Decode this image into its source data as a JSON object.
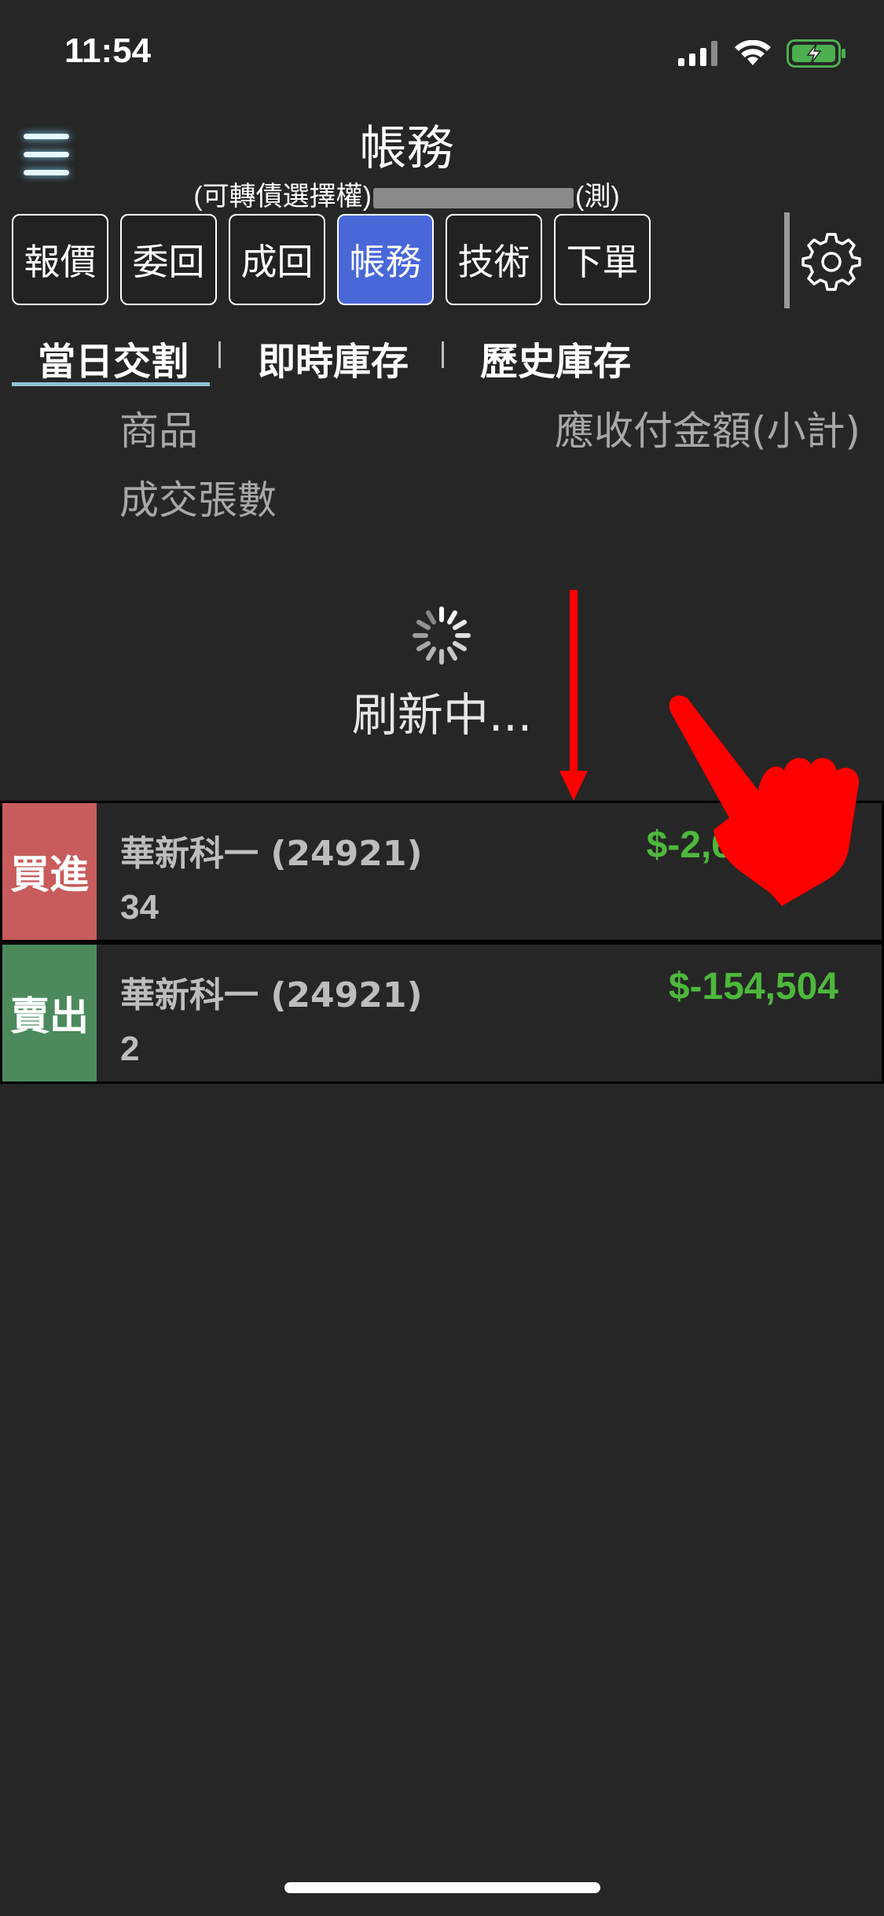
{
  "status_bar": {
    "time": "11:54"
  },
  "header": {
    "title": "帳務",
    "subtitle_prefix": "(可轉債選擇權)",
    "subtitle_suffix": "(測)"
  },
  "tabs": [
    {
      "label": "報價",
      "active": false
    },
    {
      "label": "委回",
      "active": false
    },
    {
      "label": "成回",
      "active": false
    },
    {
      "label": "帳務",
      "active": true
    },
    {
      "label": "技術",
      "active": false
    },
    {
      "label": "下單",
      "active": false
    }
  ],
  "subtabs": [
    "當日交割",
    "即時庫存",
    "歷史庫存"
  ],
  "columns": {
    "product": "商品",
    "amount": "應收付金額(小計)",
    "quantity": "成交張數"
  },
  "loading": {
    "text": "刷新中..."
  },
  "rows": [
    {
      "side": "買進",
      "side_color": "#c85c5c",
      "name": "華新科一 (24921)",
      "quantity": "34",
      "amount": "$-2,6"
    },
    {
      "side": "賣出",
      "side_color": "#4c8a5c",
      "name": "華新科一 (24921)",
      "quantity": "2",
      "amount": "$-154,504"
    }
  ],
  "colors": {
    "background": "#262626",
    "accent": "#4a67d8",
    "amount_negative": "#4db83c",
    "gesture": "#ff0000"
  },
  "icons": [
    "menu-icon",
    "gear-icon",
    "signal-icon",
    "wifi-icon",
    "battery-icon",
    "spinner-icon",
    "swipe-down-arrow-icon",
    "pointing-hand-icon"
  ]
}
